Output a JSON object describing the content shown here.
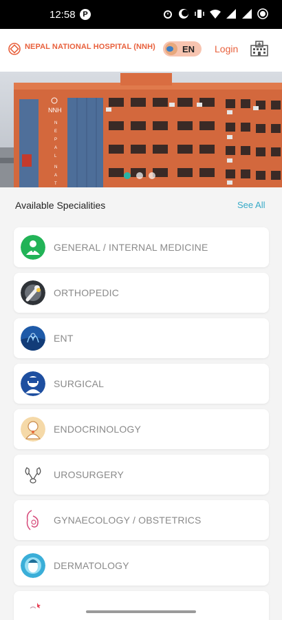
{
  "status_bar": {
    "time": "12:58",
    "notification_badge": "P",
    "icons": [
      "alarm-icon",
      "moon-icon",
      "vibrate-icon",
      "wifi-icon",
      "signal-icon",
      "signal-icon",
      "battery-icon"
    ]
  },
  "header": {
    "hospital_name": "NEPAL NATIONAL HOSPITAL (NNH)",
    "language": "EN",
    "login_label": "Login",
    "brand_color": "#e8603c"
  },
  "banner": {
    "building_sign": "NNH",
    "vertical_sign": "NEPAL NATION",
    "slide_count": 3,
    "active_slide": 1
  },
  "specialities": {
    "title": "Available Specialities",
    "see_all_label": "See All",
    "items": [
      {
        "label": "GENERAL / INTERNAL MEDICINE",
        "icon": "doctor-icon"
      },
      {
        "label": "ORTHOPEDIC",
        "icon": "bone-joint-icon"
      },
      {
        "label": "ENT",
        "icon": "ear-icon"
      },
      {
        "label": "SURGICAL",
        "icon": "surgeon-icon"
      },
      {
        "label": "ENDOCRINOLOGY",
        "icon": "endocrine-icon"
      },
      {
        "label": "UROSURGERY",
        "icon": "kidney-icon"
      },
      {
        "label": "GYNAECOLOGY / OBSTETRICS",
        "icon": "pregnancy-icon"
      },
      {
        "label": "DERMATOLOGY",
        "icon": "skin-face-icon"
      }
    ]
  }
}
